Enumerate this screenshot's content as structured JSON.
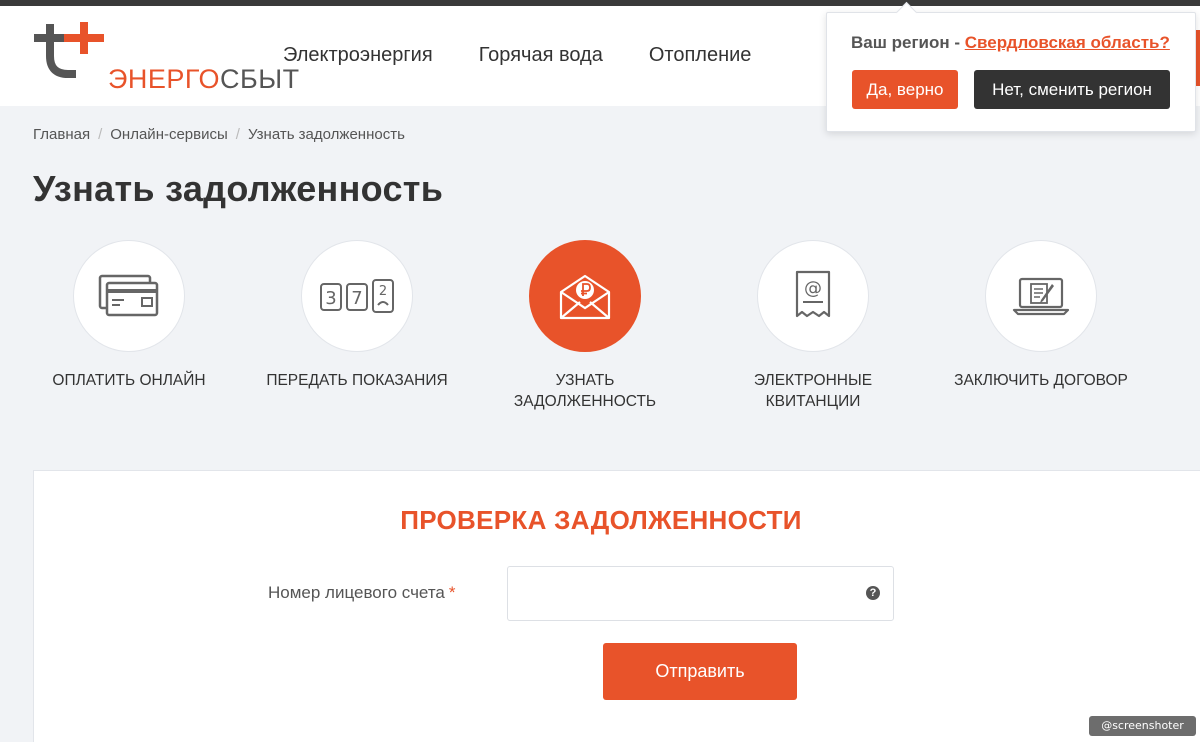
{
  "header": {
    "logo": {
      "part1": "ЭНЕРГО",
      "part2": "СБЫТ"
    },
    "nav": [
      "Электроэнергия",
      "Горячая вода",
      "Отопление"
    ]
  },
  "region_popup": {
    "prefix": "Ваш регион - ",
    "region": "Свердловская область?",
    "confirm": "Да, верно",
    "change": "Нет, сменить регион"
  },
  "breadcrumb": [
    "Главная",
    "Онлайн-сервисы",
    "Узнать задолженность"
  ],
  "page_title": "Узнать задолженность",
  "services": [
    {
      "label": "ОПЛАТИТЬ ОНЛАЙН",
      "icon": "credit-card-icon",
      "active": false
    },
    {
      "label": "ПЕРЕДАТЬ ПОКАЗАНИЯ",
      "icon": "meter-counter-icon",
      "active": false
    },
    {
      "label": "УЗНАТЬ ЗАДОЛЖЕННОСТЬ",
      "icon": "ruble-envelope-icon",
      "active": true
    },
    {
      "label": "ЭЛЕКТРОННЫЕ КВИТАНЦИИ",
      "icon": "email-receipt-icon",
      "active": false
    },
    {
      "label": "ЗАКЛЮЧИТЬ ДОГОВОР",
      "icon": "laptop-contract-icon",
      "active": false
    }
  ],
  "form": {
    "title": "ПРОВЕРКА ЗАДОЛЖЕННОСТИ",
    "account_label": "Номер лицевого счета",
    "required_mark": "*",
    "account_value": "",
    "submit": "Отправить"
  },
  "watermark": "@screenshoter",
  "colors": {
    "accent": "#e8532a",
    "dark": "#333333",
    "background": "#f1f3f6"
  }
}
